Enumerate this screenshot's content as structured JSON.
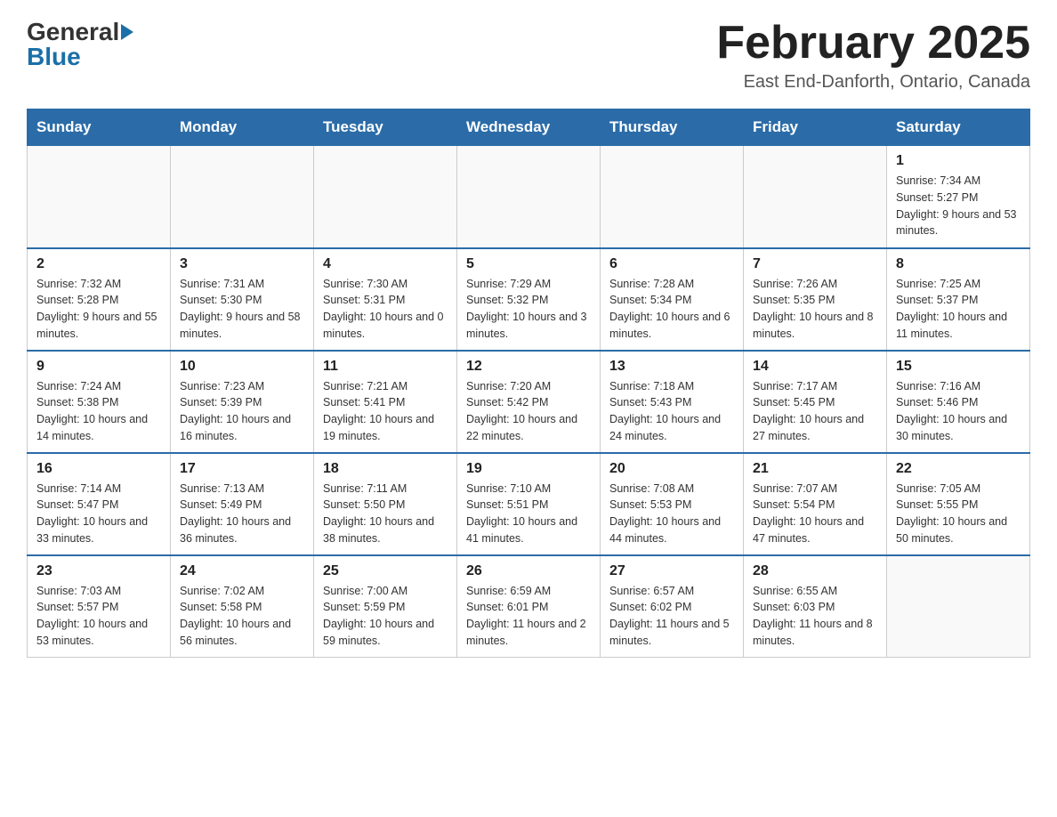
{
  "header": {
    "logo": {
      "general": "General",
      "blue": "Blue"
    },
    "title": "February 2025",
    "location": "East End-Danforth, Ontario, Canada"
  },
  "calendar": {
    "days_of_week": [
      "Sunday",
      "Monday",
      "Tuesday",
      "Wednesday",
      "Thursday",
      "Friday",
      "Saturday"
    ],
    "weeks": [
      [
        {
          "day": "",
          "info": ""
        },
        {
          "day": "",
          "info": ""
        },
        {
          "day": "",
          "info": ""
        },
        {
          "day": "",
          "info": ""
        },
        {
          "day": "",
          "info": ""
        },
        {
          "day": "",
          "info": ""
        },
        {
          "day": "1",
          "info": "Sunrise: 7:34 AM\nSunset: 5:27 PM\nDaylight: 9 hours and 53 minutes."
        }
      ],
      [
        {
          "day": "2",
          "info": "Sunrise: 7:32 AM\nSunset: 5:28 PM\nDaylight: 9 hours and 55 minutes."
        },
        {
          "day": "3",
          "info": "Sunrise: 7:31 AM\nSunset: 5:30 PM\nDaylight: 9 hours and 58 minutes."
        },
        {
          "day": "4",
          "info": "Sunrise: 7:30 AM\nSunset: 5:31 PM\nDaylight: 10 hours and 0 minutes."
        },
        {
          "day": "5",
          "info": "Sunrise: 7:29 AM\nSunset: 5:32 PM\nDaylight: 10 hours and 3 minutes."
        },
        {
          "day": "6",
          "info": "Sunrise: 7:28 AM\nSunset: 5:34 PM\nDaylight: 10 hours and 6 minutes."
        },
        {
          "day": "7",
          "info": "Sunrise: 7:26 AM\nSunset: 5:35 PM\nDaylight: 10 hours and 8 minutes."
        },
        {
          "day": "8",
          "info": "Sunrise: 7:25 AM\nSunset: 5:37 PM\nDaylight: 10 hours and 11 minutes."
        }
      ],
      [
        {
          "day": "9",
          "info": "Sunrise: 7:24 AM\nSunset: 5:38 PM\nDaylight: 10 hours and 14 minutes."
        },
        {
          "day": "10",
          "info": "Sunrise: 7:23 AM\nSunset: 5:39 PM\nDaylight: 10 hours and 16 minutes."
        },
        {
          "day": "11",
          "info": "Sunrise: 7:21 AM\nSunset: 5:41 PM\nDaylight: 10 hours and 19 minutes."
        },
        {
          "day": "12",
          "info": "Sunrise: 7:20 AM\nSunset: 5:42 PM\nDaylight: 10 hours and 22 minutes."
        },
        {
          "day": "13",
          "info": "Sunrise: 7:18 AM\nSunset: 5:43 PM\nDaylight: 10 hours and 24 minutes."
        },
        {
          "day": "14",
          "info": "Sunrise: 7:17 AM\nSunset: 5:45 PM\nDaylight: 10 hours and 27 minutes."
        },
        {
          "day": "15",
          "info": "Sunrise: 7:16 AM\nSunset: 5:46 PM\nDaylight: 10 hours and 30 minutes."
        }
      ],
      [
        {
          "day": "16",
          "info": "Sunrise: 7:14 AM\nSunset: 5:47 PM\nDaylight: 10 hours and 33 minutes."
        },
        {
          "day": "17",
          "info": "Sunrise: 7:13 AM\nSunset: 5:49 PM\nDaylight: 10 hours and 36 minutes."
        },
        {
          "day": "18",
          "info": "Sunrise: 7:11 AM\nSunset: 5:50 PM\nDaylight: 10 hours and 38 minutes."
        },
        {
          "day": "19",
          "info": "Sunrise: 7:10 AM\nSunset: 5:51 PM\nDaylight: 10 hours and 41 minutes."
        },
        {
          "day": "20",
          "info": "Sunrise: 7:08 AM\nSunset: 5:53 PM\nDaylight: 10 hours and 44 minutes."
        },
        {
          "day": "21",
          "info": "Sunrise: 7:07 AM\nSunset: 5:54 PM\nDaylight: 10 hours and 47 minutes."
        },
        {
          "day": "22",
          "info": "Sunrise: 7:05 AM\nSunset: 5:55 PM\nDaylight: 10 hours and 50 minutes."
        }
      ],
      [
        {
          "day": "23",
          "info": "Sunrise: 7:03 AM\nSunset: 5:57 PM\nDaylight: 10 hours and 53 minutes."
        },
        {
          "day": "24",
          "info": "Sunrise: 7:02 AM\nSunset: 5:58 PM\nDaylight: 10 hours and 56 minutes."
        },
        {
          "day": "25",
          "info": "Sunrise: 7:00 AM\nSunset: 5:59 PM\nDaylight: 10 hours and 59 minutes."
        },
        {
          "day": "26",
          "info": "Sunrise: 6:59 AM\nSunset: 6:01 PM\nDaylight: 11 hours and 2 minutes."
        },
        {
          "day": "27",
          "info": "Sunrise: 6:57 AM\nSunset: 6:02 PM\nDaylight: 11 hours and 5 minutes."
        },
        {
          "day": "28",
          "info": "Sunrise: 6:55 AM\nSunset: 6:03 PM\nDaylight: 11 hours and 8 minutes."
        },
        {
          "day": "",
          "info": ""
        }
      ]
    ]
  }
}
